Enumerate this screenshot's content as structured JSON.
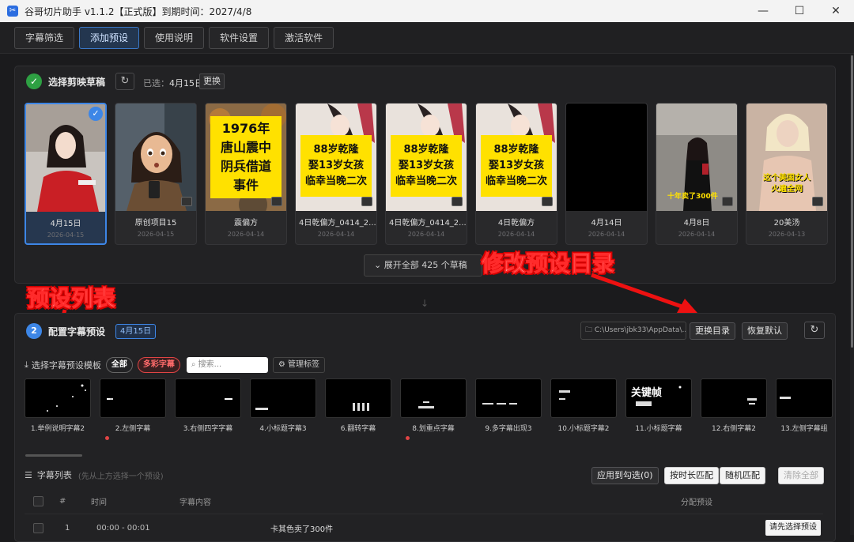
{
  "window": {
    "title": "谷哥切片助手 v1.1.2【正式版】到期时间：2027/4/8",
    "app_icon": "scissors-app-icon"
  },
  "tabs": [
    "字幕筛选",
    "添加预设",
    "使用说明",
    "软件设置",
    "激活软件"
  ],
  "active_tab": 1,
  "section1": {
    "title": "选择剪映草稿",
    "selected_prefix": "已选：",
    "selected_value": "4月15日",
    "change_button": "更换",
    "drafts": [
      {
        "name": "4月15日",
        "date": "2026-04-15"
      },
      {
        "name": "原创项目15",
        "date": "2026-04-15"
      },
      {
        "name": "震偏方",
        "date": "2026-04-14",
        "overlay": [
          "1976年",
          "唐山震中",
          "阴兵借道",
          "事件"
        ]
      },
      {
        "name": "4日乾偏方_0414_2...",
        "date": "2026-04-14",
        "overlay": [
          "88岁乾隆",
          "娶13岁女孩",
          "临幸当晚二次"
        ]
      },
      {
        "name": "4日乾偏方_0414_2...",
        "date": "2026-04-14",
        "overlay": [
          "88岁乾隆",
          "娶13岁女孩",
          "临幸当晚二次"
        ]
      },
      {
        "name": "4日乾偏方",
        "date": "2026-04-14",
        "overlay": [
          "88岁乾隆",
          "娶13岁女孩",
          "临幸当晚二次"
        ]
      },
      {
        "name": "4月14日",
        "date": "2026-04-14"
      },
      {
        "name": "4月8日",
        "date": "2026-04-14",
        "overlay": [
          "十年卖了300件"
        ]
      },
      {
        "name": "20美汤",
        "date": "2026-04-13",
        "overlay": [
          "这个美国女人",
          "火遍全网"
        ]
      }
    ],
    "expand_label": "展开全部 425 个草稿"
  },
  "annotations": {
    "modify_dir": "修改预设目录",
    "preset_list": "预设列表"
  },
  "section2": {
    "step_number": "2",
    "title": "配置字幕预设",
    "chip": "4月15日",
    "path": "C:\\Users\\jbk33\\AppData\\...",
    "change_dir_button": "更换目录",
    "restore_button": "恢复默认",
    "template_label": "选择字幕预设模板",
    "filter_all": "全部",
    "filter_colorful": "多彩字幕",
    "search_placeholder": "搜索...",
    "manage_tags": "管理标签",
    "presets": [
      {
        "name": "1.举例说明字幕2",
        "dot": false,
        "overlay": ""
      },
      {
        "name": "2.左侧字幕",
        "dot": true,
        "overlay": ""
      },
      {
        "name": "3.右侧四字字幕",
        "dot": false,
        "overlay": ""
      },
      {
        "name": "4.小标题字幕3",
        "dot": false,
        "overlay": ""
      },
      {
        "name": "6.翻转字幕",
        "dot": false,
        "overlay": ""
      },
      {
        "name": "8.划重点字幕",
        "dot": true,
        "overlay": ""
      },
      {
        "name": "9.多字幕出现3",
        "dot": false,
        "overlay": ""
      },
      {
        "name": "10.小标题字幕2",
        "dot": false,
        "overlay": ""
      },
      {
        "name": "11.小标题字幕",
        "dot": false,
        "overlay": "关键帧"
      },
      {
        "name": "12.右侧字幕2",
        "dot": false,
        "overlay": ""
      },
      {
        "name": "13.左侧字幕组",
        "dot": false,
        "overlay": ""
      }
    ],
    "list_title": "字幕列表",
    "list_hint": "(先从上方选择一个预设)",
    "apply_button": "应用到勾选(0)",
    "duration_match": "按时长匹配",
    "random_match": "随机匹配",
    "clear_all": "清除全部",
    "columns": [
      "#",
      "时间",
      "字幕内容",
      "分配预设"
    ],
    "rows": [
      {
        "index": "1",
        "time": "00:00 - 00:01",
        "content": "卡其色卖了300件",
        "assign": "请先选择预设"
      }
    ]
  }
}
